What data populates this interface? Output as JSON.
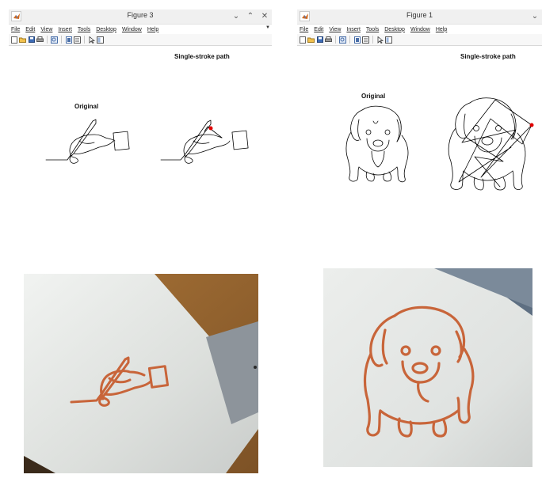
{
  "colors": {
    "titlebar": "#f0f0f0",
    "stroke_path": "#000000",
    "start_marker": "#e00000",
    "filament": "#c8653a",
    "paper": "#e9ecea",
    "wood": "#b07a3c",
    "tape": "#8d949b"
  },
  "windows": [
    {
      "title": "Figure 3",
      "menu": [
        "File",
        "Edit",
        "View",
        "Insert",
        "Tools",
        "Desktop",
        "Window",
        "Help"
      ],
      "controls": [
        "chevron-down-icon",
        "chevron-up-icon",
        "close-icon"
      ],
      "labels": {
        "original": "Original",
        "single_stroke": "Single-stroke path"
      }
    },
    {
      "title": "Figure 1",
      "menu": [
        "File",
        "Edit",
        "View",
        "Insert",
        "Tools",
        "Desktop",
        "Window",
        "Help"
      ],
      "controls": [
        "chevron-down-icon"
      ],
      "labels": {
        "original": "Original",
        "single_stroke": "Single-stroke path"
      }
    }
  ],
  "toolbar_icons": [
    "new-figure-icon",
    "open-file-icon",
    "save-icon",
    "print-icon",
    "zoom-icon",
    "data-tip-icon",
    "colorbar-icon",
    "pointer-icon",
    "legend-icon"
  ],
  "photos": [
    {
      "subject": "hand-holding-pencil-drawn-in-filament"
    },
    {
      "subject": "puppy-drawn-in-filament"
    }
  ]
}
